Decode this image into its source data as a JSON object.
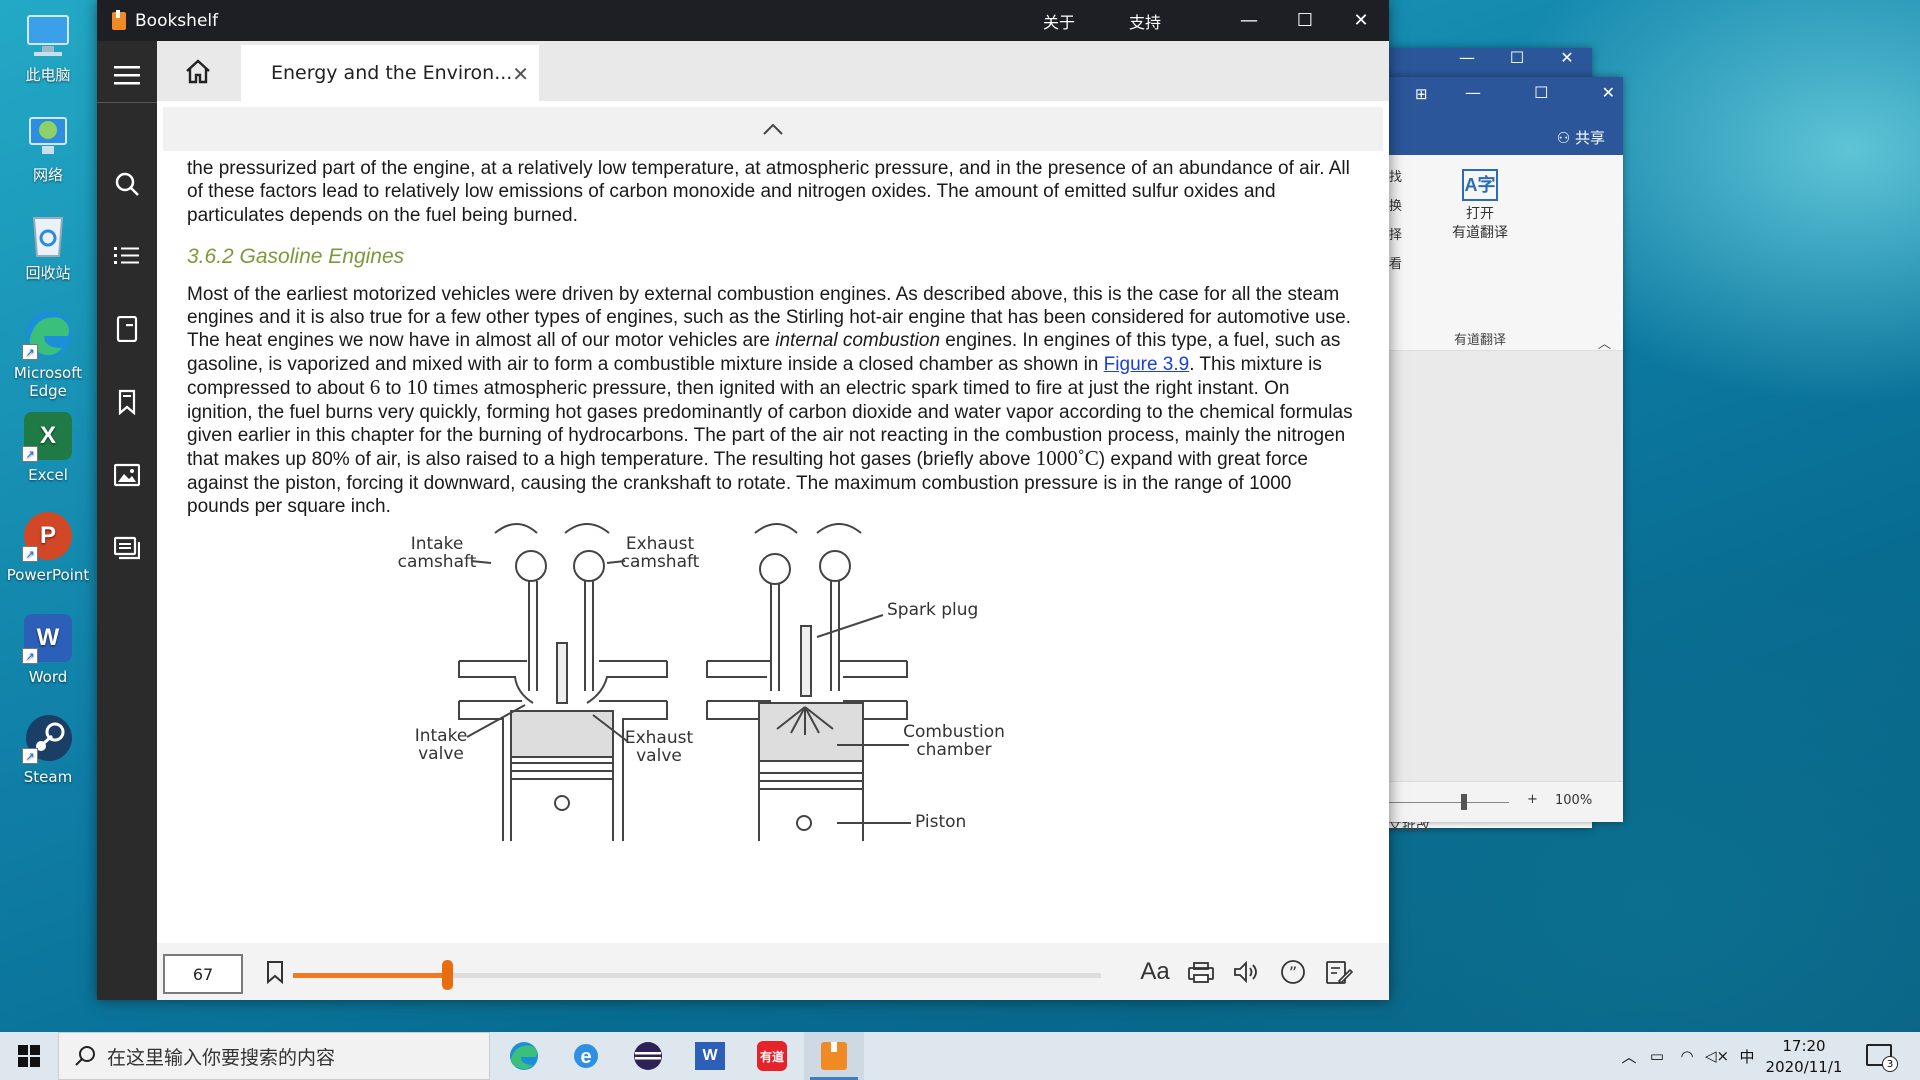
{
  "desktop": {
    "icons": [
      {
        "label": "此电脑",
        "icon": "computer-icon"
      },
      {
        "label": "网络",
        "icon": "network-icon"
      },
      {
        "label": "回收站",
        "icon": "recycle-bin-icon"
      },
      {
        "label": "Microsoft\nEdge",
        "icon": "edge-icon"
      },
      {
        "label": "Excel",
        "icon": "excel-icon"
      },
      {
        "label": "PowerPoint",
        "icon": "powerpoint-icon"
      },
      {
        "label": "Word",
        "icon": "word-icon"
      },
      {
        "label": "Steam",
        "icon": "steam-icon"
      }
    ]
  },
  "bgword": {
    "share": "共享",
    "ribbon_items": [
      "找",
      "换",
      "择",
      "看"
    ],
    "translate_btn": "打开\n有道翻译",
    "group_label": "有道翻译",
    "zoom": "100%",
    "footer_text": "文批改"
  },
  "window": {
    "title": "Bookshelf",
    "menu_about": "关于",
    "menu_support": "支持"
  },
  "tab": {
    "label": "Energy and the Environ..."
  },
  "content": {
    "p0": "the pressurized part of the engine, at a relatively low temperature, at atmospheric pressure, and in the presence of an abundance of air. All of these factors lead to relatively low emissions of carbon monoxide and nitrogen oxides. The amount of emitted sulfur oxides and particulates depends on the fuel being burned.",
    "heading": "3.6.2 Gasoline Engines",
    "p1a": "Most of the earliest motorized vehicles were driven by external combustion engines. As described above, this is the case for all the steam engines and it is also true for a few other types of engines, such as the Stirling hot-air engine that has been considered for automotive use. The heat engines we now have in almost all of our motor vehicles are ",
    "p1_em": "internal combustion",
    "p1b": " engines. In engines of this type, a fuel, such as gasoline, is vaporized and mixed with air to form a combustible mixture inside a closed chamber as shown in ",
    "p1_link": "Figure 3.9",
    "p1c": ". This mixture is compressed to about ",
    "p1_math1": "6",
    "p1d": " to ",
    "p1_math2": "10 times",
    "p1e": " atmospheric pressure, then ignited with an electric spark timed to fire at just the right instant. On ignition, the fuel burns very quickly, forming hot gases predominantly of carbon dioxide and water vapor according to the chemical formulas given earlier in this chapter for the burning of hydrocarbons. The part of the air not reacting in the combustion process, mainly the nitrogen that makes up 80% of air, is also raised to a high temperature. The resulting hot gases (briefly above ",
    "p1_math3": "1000˚C",
    "p1f": ") expand with great force against the piston, forcing it downward, causing the crankshaft to rotate. The maximum combustion pressure is in the range of 1000 pounds per square inch."
  },
  "figure": {
    "intake_camshaft": [
      "Intake",
      "camshaft"
    ],
    "exhaust_camshaft": [
      "Exhaust",
      "camshaft"
    ],
    "spark_plug": "Spark plug",
    "intake_valve": [
      "Intake",
      "valve"
    ],
    "exhaust_valve": [
      "Exhaust",
      "valve"
    ],
    "combustion_chamber": [
      "Combustion",
      "chamber"
    ],
    "piston": "Piston"
  },
  "bottombar": {
    "page": "67",
    "progress_fraction": 0.19,
    "font_btn": "Aa"
  },
  "taskbar": {
    "search_placeholder": "在这里输入你要搜索的内容",
    "ime": "中",
    "time": "17:20",
    "date": "2020/11/1",
    "notifications": "3"
  }
}
